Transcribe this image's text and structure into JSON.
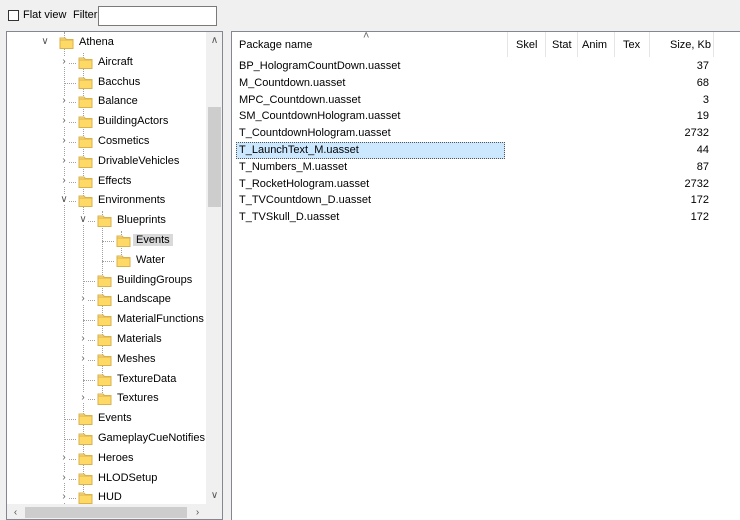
{
  "toolbar": {
    "flat_view_label": "Flat view",
    "flat_view_checked": false,
    "filter_label": "Filter:",
    "filter_value": ""
  },
  "tree": {
    "items": [
      {
        "label": "Athena",
        "expander": "expanded"
      },
      {
        "label": "Aircraft",
        "expander": "collapsed"
      },
      {
        "label": "Bacchus",
        "expander": "none"
      },
      {
        "label": "Balance",
        "expander": "collapsed"
      },
      {
        "label": "BuildingActors",
        "expander": "collapsed"
      },
      {
        "label": "Cosmetics",
        "expander": "collapsed"
      },
      {
        "label": "DrivableVehicles",
        "expander": "collapsed"
      },
      {
        "label": "Effects",
        "expander": "collapsed"
      },
      {
        "label": "Environments",
        "expander": "expanded"
      },
      {
        "label": "Blueprints",
        "expander": "expanded"
      },
      {
        "label": "Events",
        "expander": "none",
        "selected": true
      },
      {
        "label": "Water",
        "expander": "none"
      },
      {
        "label": "BuildingGroups",
        "expander": "none"
      },
      {
        "label": "Landscape",
        "expander": "collapsed"
      },
      {
        "label": "MaterialFunctions",
        "expander": "none"
      },
      {
        "label": "Materials",
        "expander": "collapsed"
      },
      {
        "label": "Meshes",
        "expander": "collapsed"
      },
      {
        "label": "TextureData",
        "expander": "none"
      },
      {
        "label": "Textures",
        "expander": "collapsed"
      },
      {
        "label": "Events",
        "expander": "none"
      },
      {
        "label": "GameplayCueNotifies",
        "expander": "none"
      },
      {
        "label": "Heroes",
        "expander": "collapsed"
      },
      {
        "label": "HLODSetup",
        "expander": "collapsed"
      },
      {
        "label": "HUD",
        "expander": "collapsed"
      }
    ]
  },
  "list": {
    "columns": [
      "Package name",
      "Skel",
      "Stat",
      "Anim",
      "Tex",
      "Size, Kb"
    ],
    "sorted_column": "Package name",
    "rows": [
      {
        "name": "BP_HologramCountDown.uasset",
        "size": "37"
      },
      {
        "name": "M_Countdown.uasset",
        "size": "68"
      },
      {
        "name": "MPC_Countdown.uasset",
        "size": "3"
      },
      {
        "name": "SM_CountdownHologram.uasset",
        "size": "19"
      },
      {
        "name": "T_CountdownHologram.uasset",
        "size": "2732"
      },
      {
        "name": "T_LaunchText_M.uasset",
        "size": "44",
        "selected": true
      },
      {
        "name": "T_Numbers_M.uasset",
        "size": "87"
      },
      {
        "name": "T_RocketHologram.uasset",
        "size": "2732"
      },
      {
        "name": "T_TVCountdown_D.uasset",
        "size": "172"
      },
      {
        "name": "T_TVSkull_D.uasset",
        "size": "172"
      }
    ]
  },
  "colors": {
    "folder_fill": "#ffe08a",
    "folder_tab": "#f4c95d",
    "selection": "#cce8ff",
    "tree_selection": "#d9d9d9"
  },
  "icons": {
    "folder": "folder-icon",
    "expanded": "chevron-down-icon",
    "collapsed": "chevron-right-icon",
    "scroll_up": "arrow-up-icon",
    "scroll_down": "arrow-down-icon",
    "scroll_left": "arrow-left-icon",
    "scroll_right": "arrow-right-icon",
    "sort": "sort-ascending-icon"
  }
}
